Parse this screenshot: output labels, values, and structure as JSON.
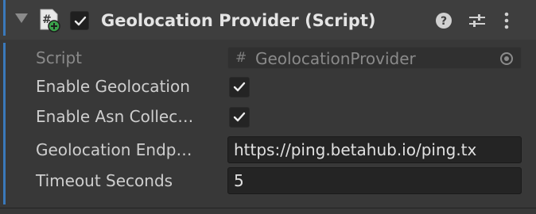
{
  "component": {
    "title": "Geolocation Provider (Script)",
    "enabled": true,
    "icons": {
      "foldout": "foldout-expanded-icon",
      "script": "script-add-icon",
      "help": "help-icon",
      "preset": "preset-sliders-icon",
      "menu": "kebab-menu-icon"
    }
  },
  "fields": {
    "script": {
      "label": "Script",
      "value": "GeolocationProvider"
    },
    "enable_geolocation": {
      "label": "Enable Geolocation",
      "checked": true
    },
    "enable_asn": {
      "label": "Enable Asn Collec…",
      "checked": true
    },
    "endpoint": {
      "label": "Geolocation Endp…",
      "value": "https://ping.betahub.io/ping.tx"
    },
    "timeout": {
      "label": "Timeout Seconds",
      "value": "5"
    }
  },
  "colors": {
    "background": "#383838",
    "header": "#3e3e3e",
    "accent_blue": "#3a79bb",
    "add_badge": "#3aa14a"
  }
}
